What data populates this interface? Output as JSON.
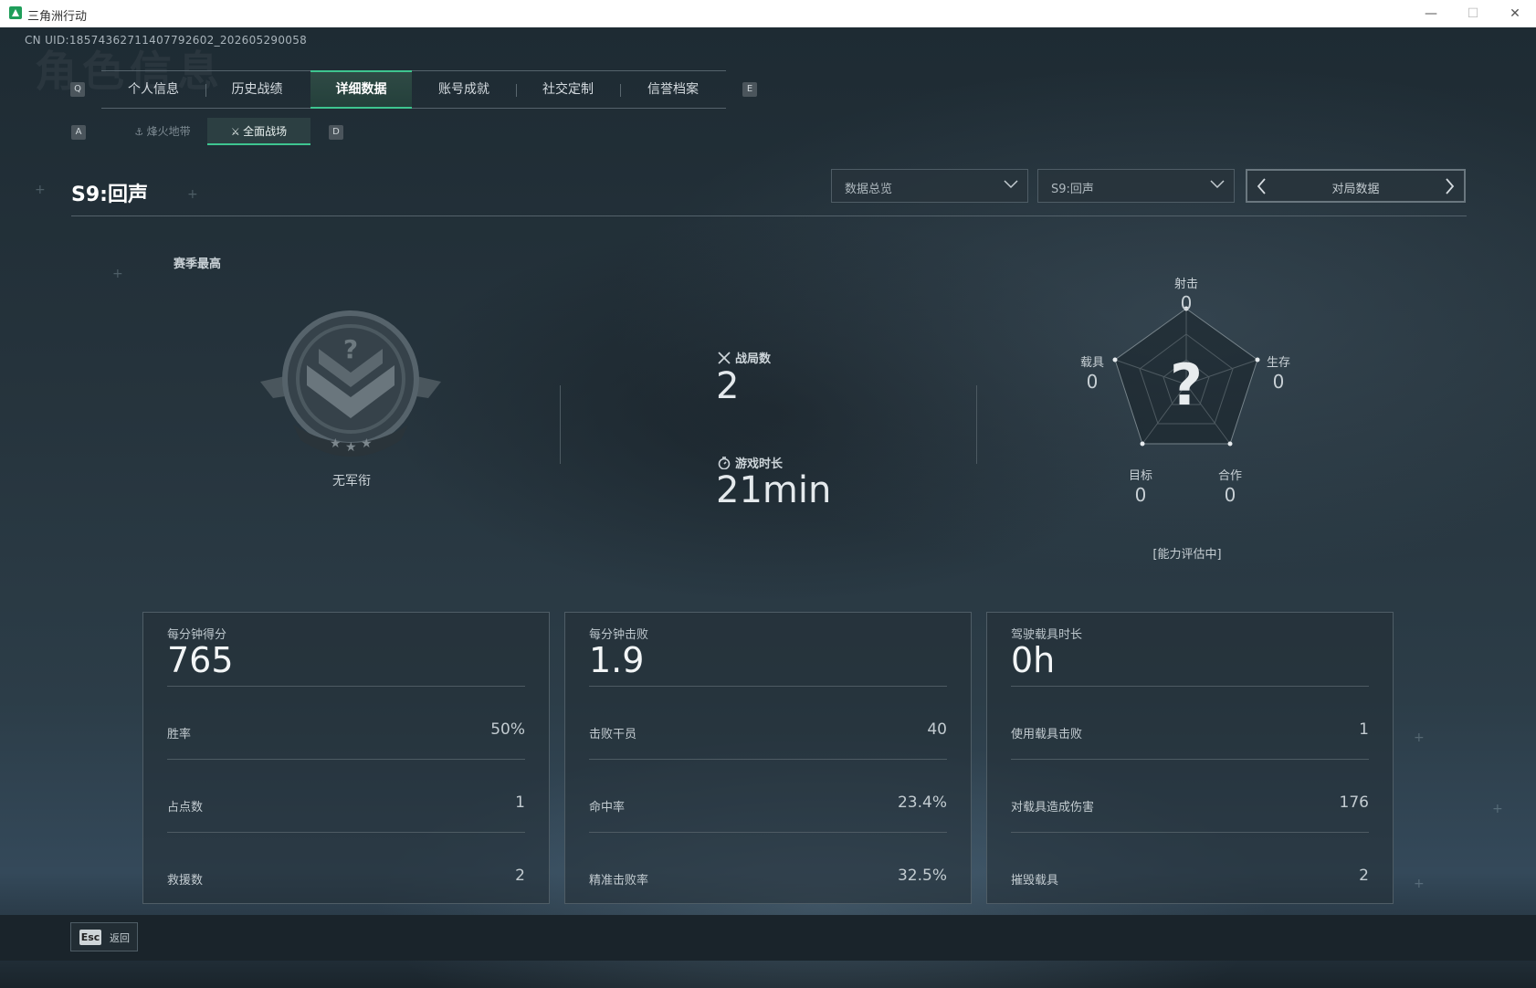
{
  "window": {
    "title": "三角洲行动",
    "minimize": "—",
    "maximize": "☐",
    "close": "✕"
  },
  "uid": "CN UID:18574362711407792602_202605290058",
  "watermark": "角色信息",
  "keys": {
    "prev_tab": "Q",
    "next_tab": "E",
    "prev_sub": "A",
    "next_sub": "D"
  },
  "tabs": [
    "个人信息",
    "历史战绩",
    "详细数据",
    "账号成就",
    "社交定制",
    "信誉档案"
  ],
  "active_tab_index": 2,
  "subtabs": {
    "inactive": "烽火地带",
    "active": "全面战场"
  },
  "season_title": "S9:回声",
  "filters": {
    "overview": "数据总览",
    "season": "S9:回声",
    "pager_label": "对局数据"
  },
  "rank": {
    "section_label": "赛季最高",
    "name": "无军衔"
  },
  "summary": {
    "matches_label": "战局数",
    "matches_value": "2",
    "playtime_label": "游戏时长",
    "playtime_value": "21min"
  },
  "radar": {
    "center_mark": "?",
    "axes": [
      {
        "label": "射击",
        "value": "0"
      },
      {
        "label": "生存",
        "value": "0"
      },
      {
        "label": "合作",
        "value": "0"
      },
      {
        "label": "目标",
        "value": "0"
      },
      {
        "label": "载具",
        "value": "0"
      }
    ],
    "status": "[能力评估中]"
  },
  "cards": [
    {
      "title": "每分钟得分",
      "value": "765",
      "rows": [
        {
          "label": "胜率",
          "value": "50%"
        },
        {
          "label": "占点数",
          "value": "1"
        },
        {
          "label": "救援数",
          "value": "2"
        }
      ]
    },
    {
      "title": "每分钟击败",
      "value": "1.9",
      "rows": [
        {
          "label": "击败干员",
          "value": "40"
        },
        {
          "label": "命中率",
          "value": "23.4%"
        },
        {
          "label": "精准击败率",
          "value": "32.5%"
        }
      ]
    },
    {
      "title": "驾驶载具时长",
      "value": "0h",
      "rows": [
        {
          "label": "使用载具击败",
          "value": "1"
        },
        {
          "label": "对载具造成伤害",
          "value": "176"
        },
        {
          "label": "摧毁载具",
          "value": "2"
        }
      ]
    }
  ],
  "back": {
    "key": "Esc",
    "label": "返回"
  },
  "colors": {
    "accent": "#3ec590",
    "background": "#1d2830"
  }
}
